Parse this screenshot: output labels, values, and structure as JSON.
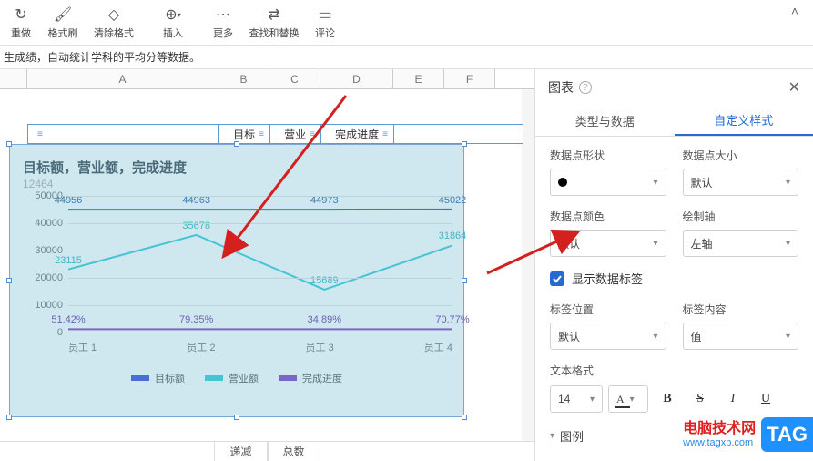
{
  "toolbar": {
    "redo": "重做",
    "format_painter": "格式刷",
    "clear_format": "清除格式",
    "insert": "插入",
    "more": "更多",
    "find_replace": "查找和替换",
    "comments": "评论"
  },
  "description": "生成绩，自动统计学科的平均分等数据。",
  "columns": {
    "A": "A",
    "B": "B",
    "C": "C",
    "D": "D",
    "E": "E",
    "F": "F"
  },
  "mini_headers": {
    "blank": "",
    "target": "目标",
    "revenue": "营业",
    "progress": "完成进度"
  },
  "bottom_tabs": {
    "desc": "递减",
    "total": "总数"
  },
  "side": {
    "title": "图表",
    "tab_data": "类型与数据",
    "tab_style": "自定义样式",
    "point_shape": "数据点形状",
    "point_size": "数据点大小",
    "point_size_val": "默认",
    "point_color": "数据点颜色",
    "point_color_val": "默认",
    "axis": "绘制轴",
    "axis_val": "左轴",
    "show_labels": "显示数据标签",
    "label_pos": "标签位置",
    "label_pos_val": "默认",
    "label_content": "标签内容",
    "label_content_val": "值",
    "text_fmt": "文本格式",
    "font_size": "14",
    "legend_section": "图例"
  },
  "chart_data": {
    "type": "line",
    "title": "目标额，营业额，完成进度",
    "subtitle": "12464",
    "categories": [
      "员工 1",
      "员工 2",
      "员工 3",
      "员工 4"
    ],
    "ylim": [
      0,
      50000
    ],
    "yticks": [
      0,
      10000,
      20000,
      30000,
      40000,
      50000
    ],
    "series": [
      {
        "name": "目标额",
        "color": "#4a6fd4",
        "values": [
          44956,
          44963,
          44973,
          45022
        ]
      },
      {
        "name": "营业额",
        "color": "#46c4d3",
        "values": [
          23115,
          35678,
          15689,
          31864
        ]
      },
      {
        "name": "完成进度",
        "color": "#7a66c7",
        "values": [
          0.5142,
          0.7935,
          0.3489,
          0.7077
        ],
        "display": [
          "51.42%",
          "79.35%",
          "34.89%",
          "70.77%"
        ],
        "axis": "secondary",
        "plotY": 1200
      }
    ]
  },
  "watermark": {
    "line1": "电脑技术网",
    "line2": "www.tagxp.com",
    "tag": "TAG"
  }
}
